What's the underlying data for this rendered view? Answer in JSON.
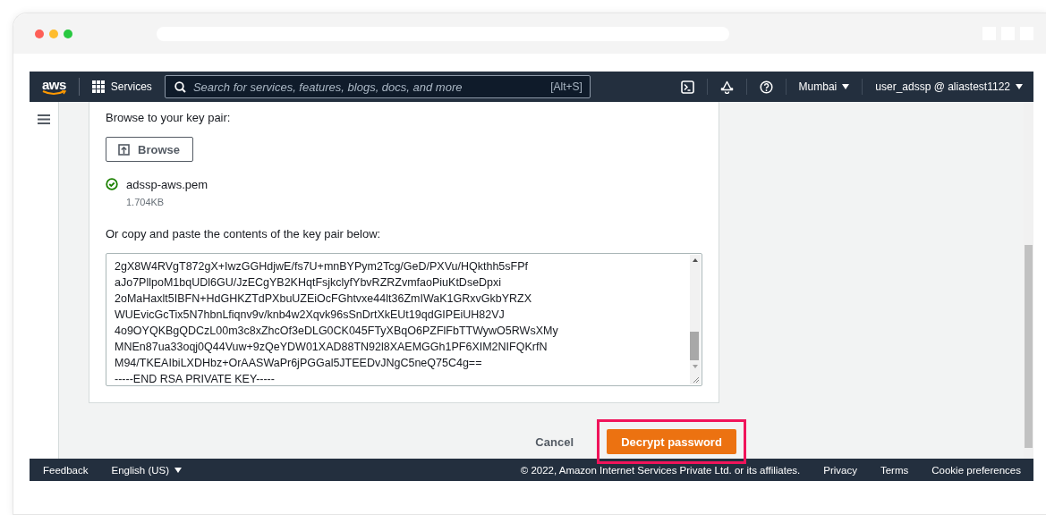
{
  "topbar": {
    "logo": "aws",
    "services": "Services",
    "search": {
      "placeholder": "Search for services, features, blogs, docs, and more",
      "shortcut": "[Alt+S]"
    },
    "region": "Mumbai",
    "account": "user_adssp @ aliastest1122"
  },
  "form": {
    "browse_label": "Browse to your key pair:",
    "browse_button": "Browse",
    "file": {
      "name": "adssp-aws.pem",
      "size": "1.704KB",
      "valid": true
    },
    "paste_label": "Or copy and paste the contents of the key pair below:",
    "key_lines": [
      "2gX8W4RVgT872gX+IwzGGHdjwE/fs7U+mnBYPym2Tcg/GeD/PXVu/HQkthh5sFPf",
      "aJo7PllpoM1bqUDl6GU/JzECgYB2KHqtFsjkclyfYbvRZRZvmfaoPiuKtDseDpxi",
      "2oMaHaxlt5IBFN+HdGHKZTdPXbuUZEiOcFGhtvxe44lt36ZmIWaK1GRxvGkbYRZX",
      "WUEvicGcTix5N7hbnLfiqnv9v/knb4w2Xqvk96sSnDrtXkEUt19qdGIPEiUH82VJ",
      "4o9OYQKBgQDCzL00m3c8xZhcOf3eDLG0CK045FTyXBqO6PZFlFbTTWywO5RWsXMy",
      "MNEn87ua33oqj0Q44Vuw+9zQeYDW01XAD88TN92l8XAEMGGh1PF6XIM2NIFQKrfN",
      "M94/TKEAIbiLXDHbz+OrAASWaPr6jPGGal5JTEEDvJNgC5neQ75C4g==",
      "-----END RSA PRIVATE KEY-----"
    ]
  },
  "actions": {
    "cancel": "Cancel",
    "submit": "Decrypt password",
    "highlighted": true
  },
  "footer": {
    "feedback": "Feedback",
    "language": "English (US)",
    "copyright": "© 2022, Amazon Internet Services Private Ltd. or its affiliates.",
    "links": [
      "Privacy",
      "Terms",
      "Cookie preferences"
    ]
  }
}
